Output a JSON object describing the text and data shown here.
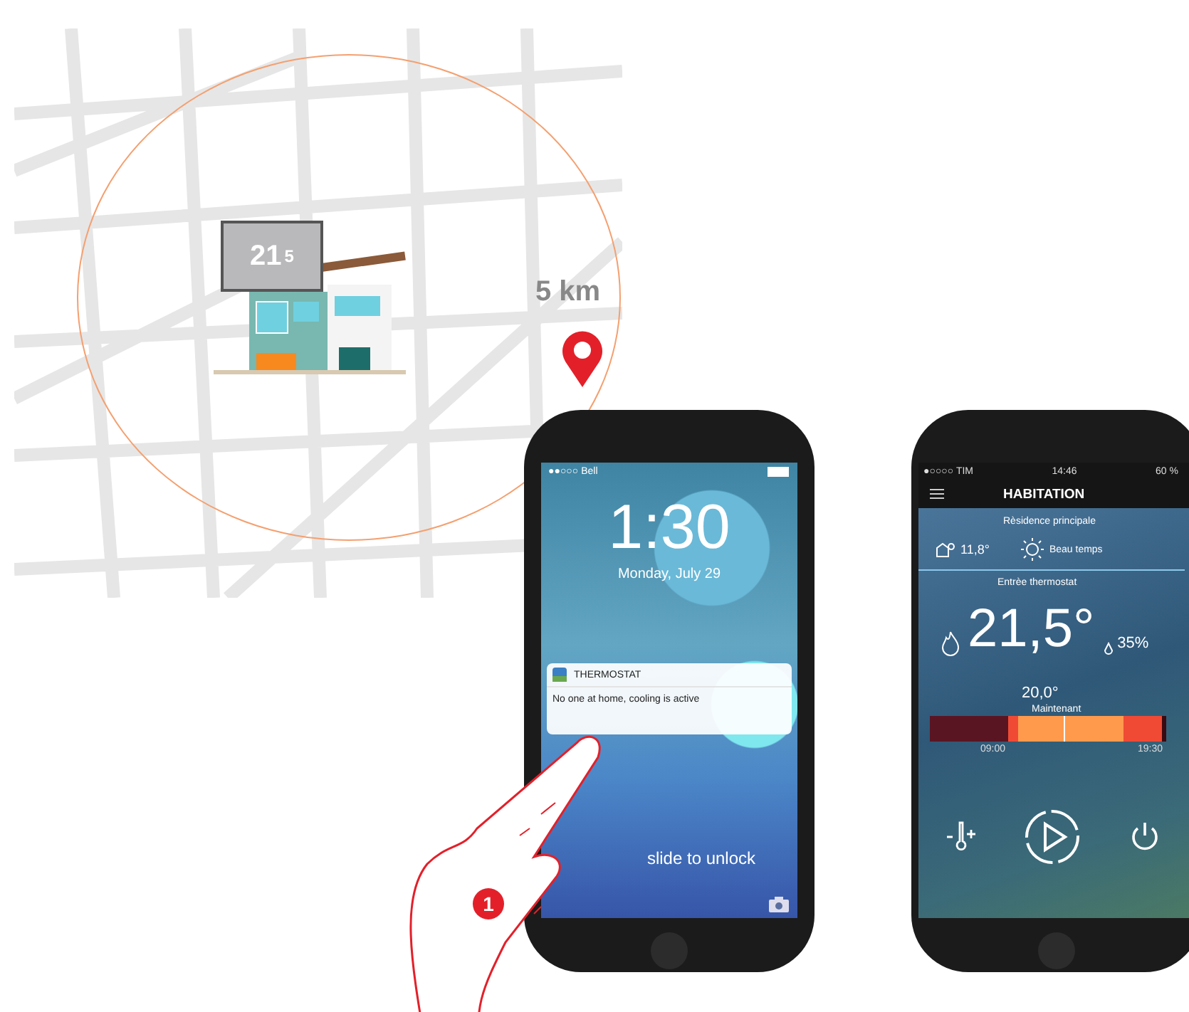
{
  "map": {
    "distance": "5 km",
    "thermostat": {
      "display": "21",
      "display_decimal": "5"
    }
  },
  "step_badge": "1",
  "lock_screen": {
    "status": {
      "carrier": "●●○○○ Bell"
    },
    "time": "1:30",
    "date": "Monday, July 29",
    "notification": {
      "app": "THERMOSTAT",
      "message": "No one at home, cooling is active"
    },
    "slide_hint": "slide to unlock"
  },
  "app_screen": {
    "status": {
      "carrier": "●○○○○ TIM",
      "time": "14:46",
      "battery": "60 %"
    },
    "title": "HABITATION",
    "location": "Rèsidence principale",
    "outdoor_temp": "11,8°",
    "weather": "Beau temps",
    "section": "Entrèe thermostat",
    "temperature": "21,5°",
    "humidity": "35%",
    "setpoint": "20,0°",
    "now_label": "Maintenant",
    "time_marks": [
      "09:00",
      "19:30"
    ]
  }
}
